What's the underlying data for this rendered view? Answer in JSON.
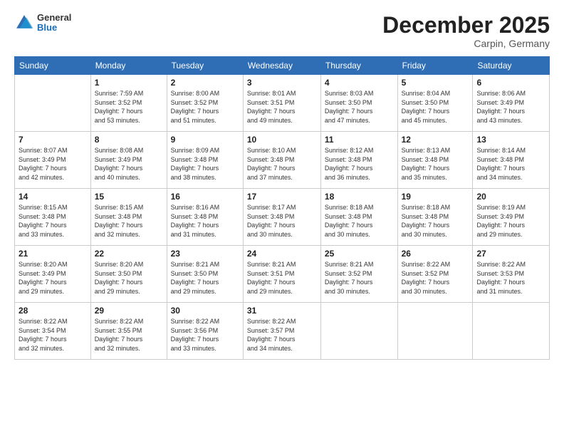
{
  "logo": {
    "general": "General",
    "blue": "Blue"
  },
  "header": {
    "month": "December 2025",
    "location": "Carpin, Germany"
  },
  "weekdays": [
    "Sunday",
    "Monday",
    "Tuesday",
    "Wednesday",
    "Thursday",
    "Friday",
    "Saturday"
  ],
  "weeks": [
    [
      {
        "day": "",
        "sunrise": "",
        "sunset": "",
        "daylight": ""
      },
      {
        "day": "1",
        "sunrise": "Sunrise: 7:59 AM",
        "sunset": "Sunset: 3:52 PM",
        "daylight": "Daylight: 7 hours and 53 minutes."
      },
      {
        "day": "2",
        "sunrise": "Sunrise: 8:00 AM",
        "sunset": "Sunset: 3:52 PM",
        "daylight": "Daylight: 7 hours and 51 minutes."
      },
      {
        "day": "3",
        "sunrise": "Sunrise: 8:01 AM",
        "sunset": "Sunset: 3:51 PM",
        "daylight": "Daylight: 7 hours and 49 minutes."
      },
      {
        "day": "4",
        "sunrise": "Sunrise: 8:03 AM",
        "sunset": "Sunset: 3:50 PM",
        "daylight": "Daylight: 7 hours and 47 minutes."
      },
      {
        "day": "5",
        "sunrise": "Sunrise: 8:04 AM",
        "sunset": "Sunset: 3:50 PM",
        "daylight": "Daylight: 7 hours and 45 minutes."
      },
      {
        "day": "6",
        "sunrise": "Sunrise: 8:06 AM",
        "sunset": "Sunset: 3:49 PM",
        "daylight": "Daylight: 7 hours and 43 minutes."
      }
    ],
    [
      {
        "day": "7",
        "sunrise": "Sunrise: 8:07 AM",
        "sunset": "Sunset: 3:49 PM",
        "daylight": "Daylight: 7 hours and 42 minutes."
      },
      {
        "day": "8",
        "sunrise": "Sunrise: 8:08 AM",
        "sunset": "Sunset: 3:49 PM",
        "daylight": "Daylight: 7 hours and 40 minutes."
      },
      {
        "day": "9",
        "sunrise": "Sunrise: 8:09 AM",
        "sunset": "Sunset: 3:48 PM",
        "daylight": "Daylight: 7 hours and 38 minutes."
      },
      {
        "day": "10",
        "sunrise": "Sunrise: 8:10 AM",
        "sunset": "Sunset: 3:48 PM",
        "daylight": "Daylight: 7 hours and 37 minutes."
      },
      {
        "day": "11",
        "sunrise": "Sunrise: 8:12 AM",
        "sunset": "Sunset: 3:48 PM",
        "daylight": "Daylight: 7 hours and 36 minutes."
      },
      {
        "day": "12",
        "sunrise": "Sunrise: 8:13 AM",
        "sunset": "Sunset: 3:48 PM",
        "daylight": "Daylight: 7 hours and 35 minutes."
      },
      {
        "day": "13",
        "sunrise": "Sunrise: 8:14 AM",
        "sunset": "Sunset: 3:48 PM",
        "daylight": "Daylight: 7 hours and 34 minutes."
      }
    ],
    [
      {
        "day": "14",
        "sunrise": "Sunrise: 8:15 AM",
        "sunset": "Sunset: 3:48 PM",
        "daylight": "Daylight: 7 hours and 33 minutes."
      },
      {
        "day": "15",
        "sunrise": "Sunrise: 8:15 AM",
        "sunset": "Sunset: 3:48 PM",
        "daylight": "Daylight: 7 hours and 32 minutes."
      },
      {
        "day": "16",
        "sunrise": "Sunrise: 8:16 AM",
        "sunset": "Sunset: 3:48 PM",
        "daylight": "Daylight: 7 hours and 31 minutes."
      },
      {
        "day": "17",
        "sunrise": "Sunrise: 8:17 AM",
        "sunset": "Sunset: 3:48 PM",
        "daylight": "Daylight: 7 hours and 30 minutes."
      },
      {
        "day": "18",
        "sunrise": "Sunrise: 8:18 AM",
        "sunset": "Sunset: 3:48 PM",
        "daylight": "Daylight: 7 hours and 30 minutes."
      },
      {
        "day": "19",
        "sunrise": "Sunrise: 8:18 AM",
        "sunset": "Sunset: 3:48 PM",
        "daylight": "Daylight: 7 hours and 30 minutes."
      },
      {
        "day": "20",
        "sunrise": "Sunrise: 8:19 AM",
        "sunset": "Sunset: 3:49 PM",
        "daylight": "Daylight: 7 hours and 29 minutes."
      }
    ],
    [
      {
        "day": "21",
        "sunrise": "Sunrise: 8:20 AM",
        "sunset": "Sunset: 3:49 PM",
        "daylight": "Daylight: 7 hours and 29 minutes."
      },
      {
        "day": "22",
        "sunrise": "Sunrise: 8:20 AM",
        "sunset": "Sunset: 3:50 PM",
        "daylight": "Daylight: 7 hours and 29 minutes."
      },
      {
        "day": "23",
        "sunrise": "Sunrise: 8:21 AM",
        "sunset": "Sunset: 3:50 PM",
        "daylight": "Daylight: 7 hours and 29 minutes."
      },
      {
        "day": "24",
        "sunrise": "Sunrise: 8:21 AM",
        "sunset": "Sunset: 3:51 PM",
        "daylight": "Daylight: 7 hours and 29 minutes."
      },
      {
        "day": "25",
        "sunrise": "Sunrise: 8:21 AM",
        "sunset": "Sunset: 3:52 PM",
        "daylight": "Daylight: 7 hours and 30 minutes."
      },
      {
        "day": "26",
        "sunrise": "Sunrise: 8:22 AM",
        "sunset": "Sunset: 3:52 PM",
        "daylight": "Daylight: 7 hours and 30 minutes."
      },
      {
        "day": "27",
        "sunrise": "Sunrise: 8:22 AM",
        "sunset": "Sunset: 3:53 PM",
        "daylight": "Daylight: 7 hours and 31 minutes."
      }
    ],
    [
      {
        "day": "28",
        "sunrise": "Sunrise: 8:22 AM",
        "sunset": "Sunset: 3:54 PM",
        "daylight": "Daylight: 7 hours and 32 minutes."
      },
      {
        "day": "29",
        "sunrise": "Sunrise: 8:22 AM",
        "sunset": "Sunset: 3:55 PM",
        "daylight": "Daylight: 7 hours and 32 minutes."
      },
      {
        "day": "30",
        "sunrise": "Sunrise: 8:22 AM",
        "sunset": "Sunset: 3:56 PM",
        "daylight": "Daylight: 7 hours and 33 minutes."
      },
      {
        "day": "31",
        "sunrise": "Sunrise: 8:22 AM",
        "sunset": "Sunset: 3:57 PM",
        "daylight": "Daylight: 7 hours and 34 minutes."
      },
      {
        "day": "",
        "sunrise": "",
        "sunset": "",
        "daylight": ""
      },
      {
        "day": "",
        "sunrise": "",
        "sunset": "",
        "daylight": ""
      },
      {
        "day": "",
        "sunrise": "",
        "sunset": "",
        "daylight": ""
      }
    ]
  ]
}
